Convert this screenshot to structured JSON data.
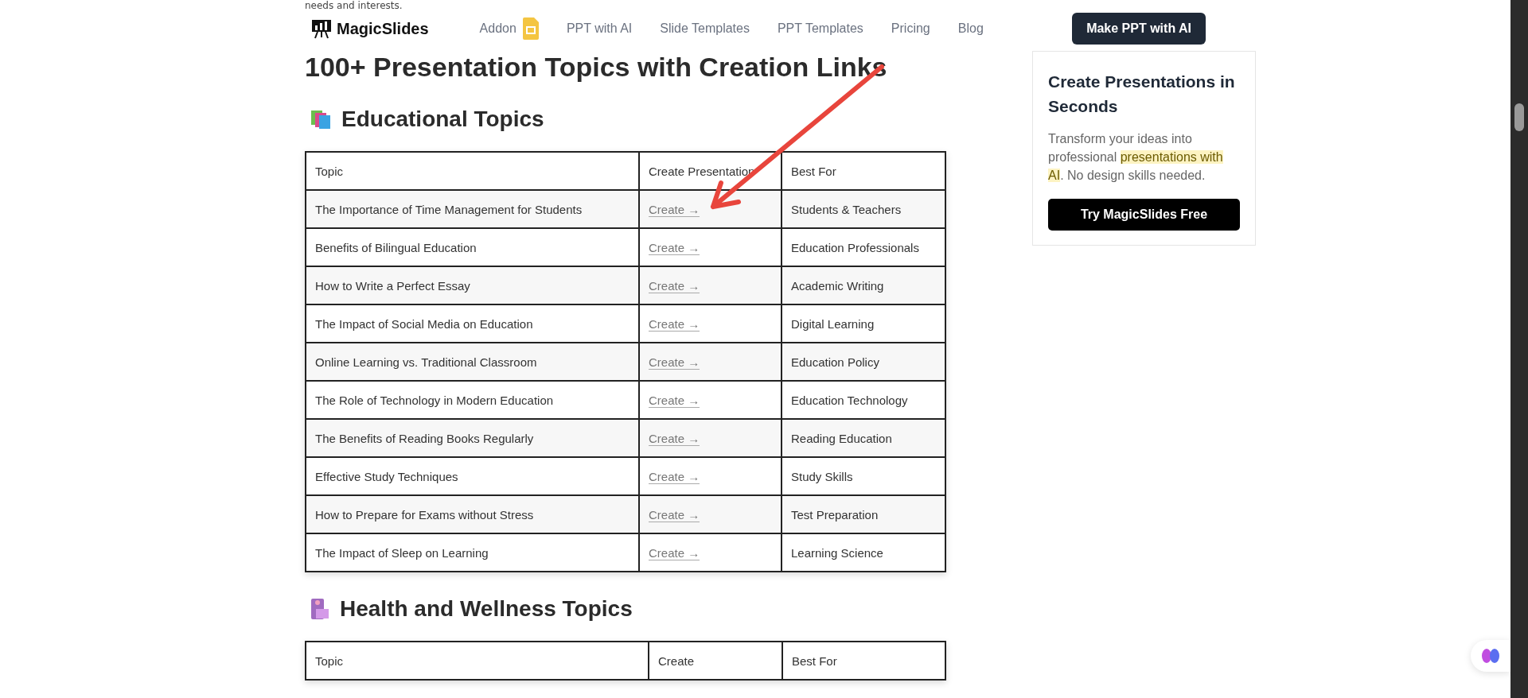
{
  "intro_text": "needs and interests.",
  "header": {
    "logo": "MagicSlides",
    "nav": [
      {
        "label": "Addon",
        "kind": "addon"
      },
      {
        "label": "PPT with AI",
        "kind": "link"
      },
      {
        "label": "Slide Templates",
        "kind": "link"
      },
      {
        "label": "PPT Templates",
        "kind": "link"
      },
      {
        "label": "Pricing",
        "kind": "link"
      },
      {
        "label": "Blog",
        "kind": "link"
      }
    ],
    "cta": "Make PPT with AI"
  },
  "title": "100+ Presentation Topics with Creation Links",
  "sections": [
    {
      "heading": "Educational Topics",
      "columns": [
        "Topic",
        "Create Presentation",
        "Best For"
      ],
      "rows": [
        {
          "topic": "The Importance of Time Management for Students",
          "link": "Create →",
          "best_for": "Students & Teachers"
        },
        {
          "topic": "Benefits of Bilingual Education",
          "link": "Create →",
          "best_for": "Education Professionals"
        },
        {
          "topic": "How to Write a Perfect Essay",
          "link": "Create →",
          "best_for": "Academic Writing"
        },
        {
          "topic": "The Impact of Social Media on Education",
          "link": "Create →",
          "best_for": "Digital Learning"
        },
        {
          "topic": "Online Learning vs. Traditional Classroom",
          "link": "Create →",
          "best_for": "Education Policy"
        },
        {
          "topic": "The Role of Technology in Modern Education",
          "link": "Create →",
          "best_for": "Education Technology"
        },
        {
          "topic": "The Benefits of Reading Books Regularly",
          "link": "Create →",
          "best_for": "Reading Education"
        },
        {
          "topic": "Effective Study Techniques",
          "link": "Create →",
          "best_for": "Study Skills"
        },
        {
          "topic": "How to Prepare for Exams without Stress",
          "link": "Create →",
          "best_for": "Test Preparation"
        },
        {
          "topic": "The Impact of Sleep on Learning",
          "link": "Create →",
          "best_for": "Learning Science"
        }
      ]
    },
    {
      "heading": "Health and Wellness Topics",
      "columns": [
        "Topic",
        "Create",
        "Best For"
      ]
    }
  ],
  "sidebar": {
    "title": "Create Presentations in Seconds",
    "text_before": "Transform your ideas into professional ",
    "highlight": "presentations with AI",
    "text_after": ". No design skills needed.",
    "button": "Try MagicSlides Free"
  }
}
